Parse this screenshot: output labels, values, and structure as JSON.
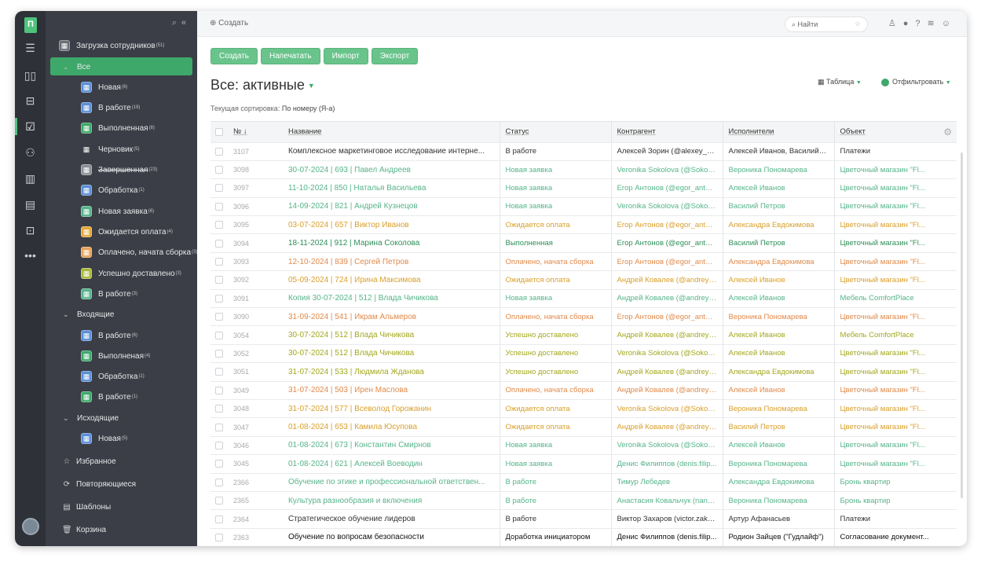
{
  "nav": {
    "logo": "П",
    "icons": [
      "menu-icon",
      "board-icon",
      "inbox-icon",
      "tasks-icon",
      "people-icon",
      "analytics-icon",
      "docs-icon",
      "contacts-icon",
      "more-icon"
    ]
  },
  "sidebar": {
    "header": {
      "label": "Загрузка сотрудников",
      "count": "(51)"
    },
    "items": [
      {
        "label": "Все",
        "count": "",
        "level": 0,
        "type": "group",
        "color": ""
      },
      {
        "label": "Новая",
        "count": "(6)",
        "level": 1,
        "color": "#5b8ed6"
      },
      {
        "label": "В работе",
        "count": "(19)",
        "level": 1,
        "color": "#5b8ed6"
      },
      {
        "label": "Выполненная",
        "count": "(8)",
        "level": 1,
        "color": "#3ea86a"
      },
      {
        "label": "Черновик",
        "count": "(5)",
        "level": 1,
        "color": ""
      },
      {
        "label": "Завершенная",
        "count": "(23)",
        "level": 1,
        "color": "#8a8e96",
        "strike": true
      },
      {
        "label": "Обработка",
        "count": "(1)",
        "level": 1,
        "color": "#5b8ed6"
      },
      {
        "label": "Новая заявка",
        "count": "(6)",
        "level": 1,
        "color": "#56b48a"
      },
      {
        "label": "Ожидается оплата",
        "count": "(4)",
        "level": 1,
        "color": "#e3a93a"
      },
      {
        "label": "Оплачено, начата сборка",
        "count": "(3)",
        "level": 1,
        "color": "#e8a25a"
      },
      {
        "label": "Успешно доставлено",
        "count": "(3)",
        "level": 1,
        "color": "#a8b83a"
      },
      {
        "label": "В работе",
        "count": "(3)",
        "level": 1,
        "color": "#56b48a"
      },
      {
        "label": "Входящие",
        "count": "",
        "level": 0,
        "type": "group",
        "color": ""
      },
      {
        "label": "В работе",
        "count": "(6)",
        "level": 1,
        "color": "#5b8ed6"
      },
      {
        "label": "Выполненая",
        "count": "(4)",
        "level": 1,
        "color": "#3ea86a"
      },
      {
        "label": "Обработка",
        "count": "(1)",
        "level": 1,
        "color": "#5b8ed6"
      },
      {
        "label": "В работе",
        "count": "(1)",
        "level": 1,
        "color": "#3ea86a"
      },
      {
        "label": "Исходящие",
        "count": "",
        "level": 0,
        "type": "group",
        "color": ""
      },
      {
        "label": "Новая",
        "count": "(5)",
        "level": 1,
        "color": "#5b8ed6"
      }
    ],
    "bottom": [
      {
        "label": "Избранное",
        "icon": "star-icon"
      },
      {
        "label": "Повторяющиеся",
        "icon": "repeat-icon"
      },
      {
        "label": "Шаблоны",
        "icon": "template-icon"
      },
      {
        "label": "Корзина",
        "icon": "trash-icon"
      }
    ]
  },
  "topbar": {
    "create": "Создать",
    "search_placeholder": "Найти"
  },
  "toolbar": {
    "buttons": [
      "Создать",
      "Напечатать",
      "Импорт",
      "Экспорт"
    ]
  },
  "page": {
    "title": "Все: активные",
    "view": "Таблица",
    "filter": "Отфильтровать",
    "sort_label": "Текущая сортировка:",
    "sort_value": "По номеру (Я-а)"
  },
  "table": {
    "headers": {
      "num": "№",
      "name": "Название",
      "status": "Статус",
      "contractor": "Контрагент",
      "executors": "Исполнители",
      "object": "Объект"
    },
    "rows": [
      {
        "num": "3107",
        "name": "Комплексное маркетинговое исследование интерне...",
        "status": "В работе",
        "contractor": "Алексей Зорин (@alexey_zor...",
        "exec": "Алексей Иванов, Василий П...",
        "object": "Платежи",
        "color": "#333"
      },
      {
        "num": "3098",
        "name": "30-07-2024 | 693 | Павел Андреев",
        "status": "Новая заявка",
        "contractor": "Veronika Sokolova (@Sokolo...",
        "exec": "Вероника Пономарева",
        "object": "Цветочный магазин \"Fl...",
        "color": "#56b48a"
      },
      {
        "num": "3097",
        "name": "11-10-2024 | 850 | Наталья Васильева",
        "status": "Новая заявка",
        "contractor": "Егор Антонов (@egor_anton...",
        "exec": "Алексей Иванов",
        "object": "Цветочный магазин \"Fl...",
        "color": "#56b48a"
      },
      {
        "num": "3096",
        "name": "14-09-2024 | 821 | Андрей Кузнецов",
        "status": "Новая заявка",
        "contractor": "Veronika Sokolova (@Sokolo...",
        "exec": "Василий Петров",
        "object": "Цветочный магазин \"Fl...",
        "color": "#56b48a"
      },
      {
        "num": "3095",
        "name": "03-07-2024 | 657 | Виктор Иванов",
        "status": "Ожидается оплата",
        "contractor": "Егор Антонов (@egor_anton...",
        "exec": "Александра Евдокимова",
        "object": "Цветочный магазин \"Fl...",
        "color": "#d9a02c"
      },
      {
        "num": "3094",
        "name": "18-11-2024 | 912 | Марина Соколова",
        "status": "Выполненная",
        "contractor": "Егор Антонов (@egor_anton...",
        "exec": "Василий Петров",
        "object": "Цветочный магазин \"Fl...",
        "color": "#2e8f58"
      },
      {
        "num": "3093",
        "name": "12-10-2024 | 839 | Сергей Петров",
        "status": "Оплачено, начата сборка",
        "contractor": "Егор Антонов (@egor_anton...",
        "exec": "Александра Евдокимова",
        "object": "Цветочный магазин \"Fl...",
        "color": "#e08a4a"
      },
      {
        "num": "3092",
        "name": "05-09-2024 | 724 | Ирина Максимова",
        "status": "Ожидается оплата",
        "contractor": "Андрей Ковалев (@andrey_k...",
        "exec": "Алексей Иванов",
        "object": "Цветочный магазин \"Fl...",
        "color": "#d9a02c"
      },
      {
        "num": "3091",
        "name": "Копия 30-07-2024 | 512 | Влада Чичикова",
        "status": "Новая заявка",
        "contractor": "Андрей Ковалев (@andrey_k...",
        "exec": "Алексей Иванов",
        "object": "Мебель ComfortPlace",
        "color": "#56b48a"
      },
      {
        "num": "3090",
        "name": "31-09-2024 | 541 | Икрам Альмеров",
        "status": "Оплачено, начата сборка",
        "contractor": "Егор Антонов (@egor_anton...",
        "exec": "Вероника Пономарева",
        "object": "Цветочный магазин \"Fl...",
        "color": "#e08a4a"
      },
      {
        "num": "3054",
        "name": "30-07-2024 | 512 | Влада Чичикова",
        "status": "Успешно доставлено",
        "contractor": "Андрей Ковалев (@andrey_k...",
        "exec": "Алексей Иванов",
        "object": "Мебель ComfortPlace",
        "color": "#a3a81e"
      },
      {
        "num": "3052",
        "name": "30-07-2024 | 512 | Влада Чичикова",
        "status": "Успешно доставлено",
        "contractor": "Veronika Sokolova (@Sokolo...",
        "exec": "Алексей Иванов",
        "object": "Цветочный магазин \"Fl...",
        "color": "#a3a81e"
      },
      {
        "num": "3051",
        "name": "31-07-2024 | 533 | Людмила Жданова",
        "status": "Успешно доставлено",
        "contractor": "Андрей Ковалев (@andrey_k...",
        "exec": "Александра Евдокимова",
        "object": "Цветочный магазин \"Fl...",
        "color": "#a3a81e"
      },
      {
        "num": "3049",
        "name": "31-07-2024 | 503 | Ирен Маслова",
        "status": "Оплачено, начата сборка",
        "contractor": "Андрей Ковалев (@andrey_k...",
        "exec": "Алексей Иванов",
        "object": "Цветочный магазин \"Fl...",
        "color": "#e08a4a"
      },
      {
        "num": "3048",
        "name": "31-07-2024 | 577 | Всеволод Горожанин",
        "status": "Ожидается оплата",
        "contractor": "Veronika Sokolova (@Sokolo...",
        "exec": "Вероника Пономарева",
        "object": "Цветочный магазин \"Fl...",
        "color": "#d9a02c"
      },
      {
        "num": "3047",
        "name": "01-08-2024 | 653 | Камила Юсупова",
        "status": "Ожидается оплата",
        "contractor": "Андрей Ковалев (@andrey_k...",
        "exec": "Василий Петров",
        "object": "Цветочный магазин \"Fl...",
        "color": "#d9a02c"
      },
      {
        "num": "3046",
        "name": "01-08-2024 | 673 | Константин Смирнов",
        "status": "Новая заявка",
        "contractor": "Veronika Sokolova (@Sokolo...",
        "exec": "Алексей Иванов",
        "object": "Цветочный магазин \"Fl...",
        "color": "#56b48a"
      },
      {
        "num": "3045",
        "name": "01-08-2024 | 621 | Алексей Воеводин",
        "status": "Новая заявка",
        "contractor": "Денис Филиппов (denis.filip...",
        "exec": "Вероника Пономарева",
        "object": "Цветочный магазин \"Fl...",
        "color": "#56b48a"
      },
      {
        "num": "2366",
        "name": "Обучение по этике и профессиональной ответствен...",
        "status": "В работе",
        "contractor": "Тимур Лебедев",
        "exec": "Александра Евдокимова",
        "object": "Бронь квартир",
        "color": "#56b48a"
      },
      {
        "num": "2365",
        "name": "Культура разнообразия и включения",
        "status": "В работе",
        "contractor": "Анастасия Ковальчук (nanat...",
        "exec": "Вероника Пономарева",
        "object": "Бронь квартир",
        "color": "#56b48a"
      },
      {
        "num": "2364",
        "name": "Стратегическое обучение лидеров",
        "status": "В работе",
        "contractor": "Виктор Захаров (victor.zakha...",
        "exec": "Артур Афанасьев",
        "object": "Платежи",
        "color": "#333"
      },
      {
        "num": "2363",
        "name": "Обучение по вопросам безопасности",
        "status": "Доработка инициатором",
        "contractor": "Денис Филиппов (denis.filip...",
        "exec": "Родион Зайцев (\"Гудлайф\")",
        "object": "Согласование документ...",
        "color": "#111"
      }
    ]
  }
}
